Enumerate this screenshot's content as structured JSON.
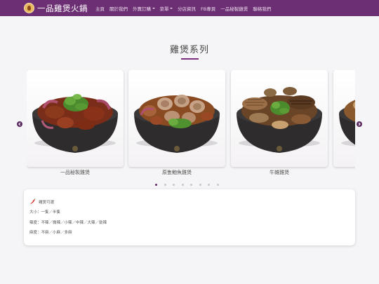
{
  "header": {
    "brand": "一品雞煲火鍋",
    "nav": [
      {
        "label": "主頁",
        "dropdown": false
      },
      {
        "label": "關於我們",
        "dropdown": false
      },
      {
        "label": "外賣訂購",
        "dropdown": true
      },
      {
        "label": "菜單",
        "dropdown": true
      },
      {
        "label": "分店資訊",
        "dropdown": false
      },
      {
        "label": "FB專頁",
        "dropdown": false
      },
      {
        "label": "一品秘製雞煲",
        "dropdown": false
      },
      {
        "label": "聯絡我們",
        "dropdown": false
      }
    ]
  },
  "section": {
    "title": "雞煲系列"
  },
  "carousel": {
    "items": [
      {
        "label": "一品秘製雞煲"
      },
      {
        "label": "原隻鮑魚雞煲"
      },
      {
        "label": "牛雜雞煲"
      },
      {
        "label": ""
      }
    ],
    "slide_count": 8,
    "active_slide": 1
  },
  "info": {
    "heading": "雞煲可選",
    "size": "大小：一隻／半隻",
    "spice": "辣度：不辣／微辣／小辣／中辣／大辣／勁辣",
    "numbing": "麻度：不麻／小麻／多麻"
  },
  "icons": {
    "brand_logo": "chef-logo-icon",
    "chili": "chili-pepper-icon",
    "prev": "chevron-left-icon",
    "next": "chevron-right-icon"
  },
  "colors": {
    "navbar": "#6c2f73",
    "accent": "#7b2d80",
    "arrow": "#5b2a60"
  }
}
